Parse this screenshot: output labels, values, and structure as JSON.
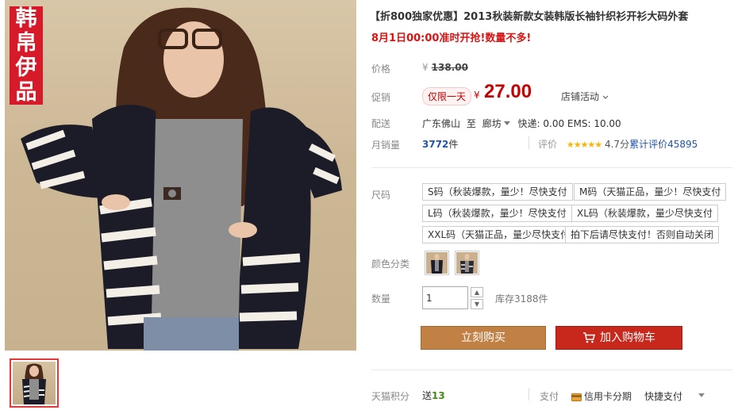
{
  "brand": {
    "stamp_chars": [
      "韩",
      "帛",
      "伊",
      "品"
    ]
  },
  "product": {
    "title": "【折800独家优惠】2013秋装新款女装韩版长袖针织衫开衫大码外套",
    "subtitle": "8月1日00:00准时开抢!数量不多!"
  },
  "price": {
    "label": "价格",
    "currency": "¥",
    "original": "138.00"
  },
  "promo": {
    "label": "促销",
    "badge": "仅限一天",
    "currency": "¥",
    "price": "27.00",
    "store_activity": "店铺活动"
  },
  "shipping": {
    "label": "配送",
    "from": "广东佛山",
    "to_word": "至",
    "to": "廊坊",
    "fees": "快递: 0.00 EMS: 10.00"
  },
  "sales": {
    "label": "月销量",
    "count": "3772",
    "unit": "件",
    "rating_label": "评价",
    "stars": "★★★★★",
    "score": "4.7分",
    "total": "累计评价45895"
  },
  "size": {
    "label": "尺码",
    "options": [
      "S码（秋装爆款，量少！尽快支付",
      "M码（天猫正品，量少！尽快支付",
      "L码（秋装爆款，量少！尽快支付",
      "XL码（秋装爆款，量少尽快支付",
      "XXL码（天猫正品，量少尽快支付",
      "拍下后请尽快支付！否则自动关闭"
    ]
  },
  "color": {
    "label": "颜色分类"
  },
  "quantity": {
    "label": "数量",
    "value": "1",
    "up": "▲",
    "down": "▼",
    "stock": "库存3188件"
  },
  "actions": {
    "buy_now": "立刻购买",
    "add_cart": "加入购物车"
  },
  "footer": {
    "points_label": "天猫积分",
    "points_prefix": "送",
    "points_value": "13",
    "pay_label": "支付",
    "pay_method1": "信用卡分期",
    "pay_method2": "快捷支付"
  },
  "colors": {
    "accent_red": "#c40000",
    "buy_button": "#c28144",
    "cart_button": "#c8281c",
    "link_blue": "#2254a8"
  }
}
